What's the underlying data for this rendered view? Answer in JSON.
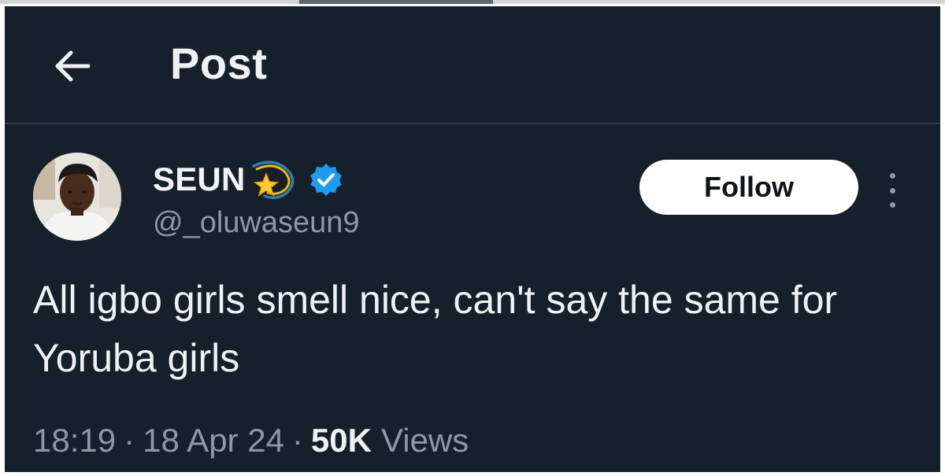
{
  "header": {
    "title": "Post",
    "back_icon": "arrow-left-icon"
  },
  "author": {
    "display_name": "SEUN",
    "name_emoji": "dizzy-star-icon",
    "verified_icon": "verified-badge-icon",
    "handle": "@_oluwaseun9",
    "avatar": "profile-photo"
  },
  "actions": {
    "follow_label": "Follow",
    "more_icon": "more-vertical-icon"
  },
  "tweet": {
    "text": "All igbo girls smell nice, can't say the same for Yoruba girls"
  },
  "meta": {
    "time": "18:19",
    "separator": "·",
    "date": "18 Apr 24",
    "views_count": "50K",
    "views_label": "Views"
  },
  "colors": {
    "background": "#16202b",
    "text_primary": "#eef2f5",
    "text_secondary": "#8b98a5",
    "verified_blue": "#1d9bf0",
    "follow_bg": "#ffffff"
  }
}
